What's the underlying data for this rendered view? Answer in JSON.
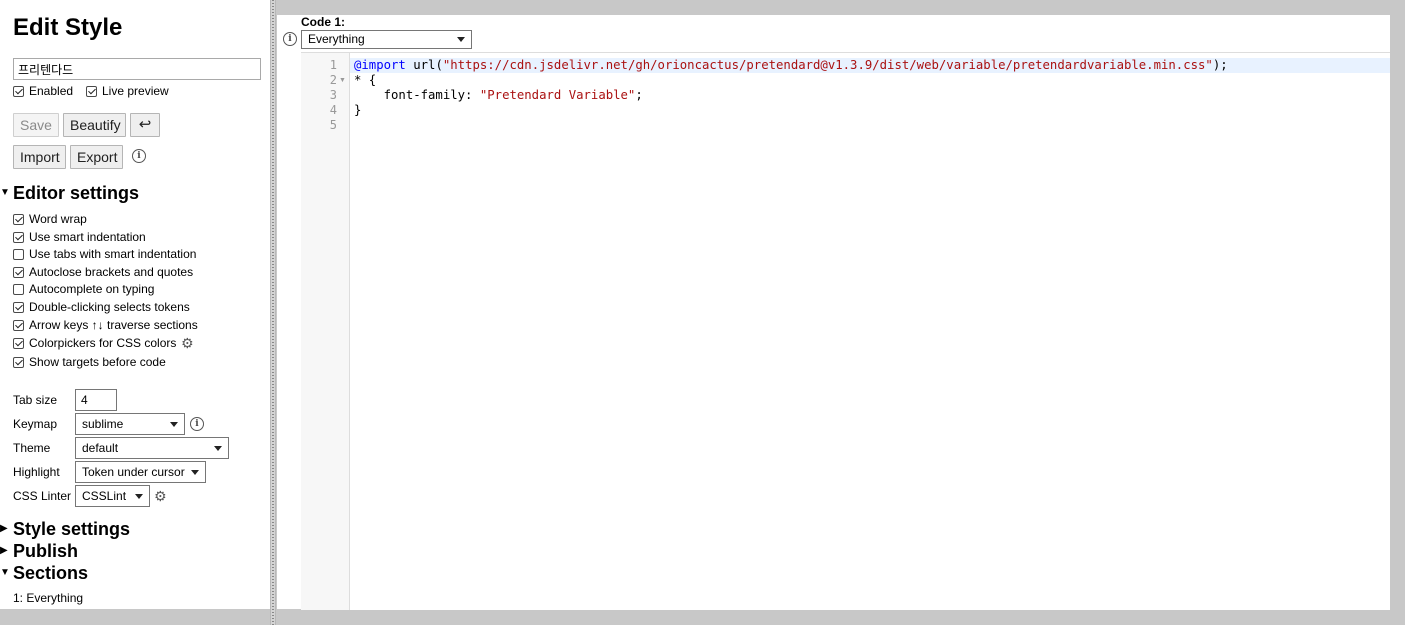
{
  "sidebar": {
    "title": "Edit Style",
    "style_name": "프리텐다드",
    "enabled_label": "Enabled",
    "live_preview_label": "Live preview",
    "save_label": "Save",
    "beautify_label": "Beautify",
    "undo_glyph": "↩",
    "import_label": "Import",
    "export_label": "Export",
    "editor_settings": {
      "heading": "Editor settings",
      "options": [
        {
          "label": "Word wrap",
          "checked": true
        },
        {
          "label": "Use smart indentation",
          "checked": true
        },
        {
          "label": "Use tabs with smart indentation",
          "checked": false
        },
        {
          "label": "Autoclose brackets and quotes",
          "checked": true
        },
        {
          "label": "Autocomplete on typing",
          "checked": false
        },
        {
          "label": "Double-clicking selects tokens",
          "checked": true
        },
        {
          "label": "Arrow keys ↑↓ traverse sections",
          "checked": true
        },
        {
          "label": "Colorpickers for CSS colors",
          "checked": true
        },
        {
          "label": "Show targets before code",
          "checked": true
        }
      ],
      "tab_size_label": "Tab size",
      "tab_size_value": "4",
      "keymap_label": "Keymap",
      "keymap_value": "sublime",
      "theme_label": "Theme",
      "theme_value": "default",
      "highlight_label": "Highlight",
      "highlight_value": "Token under cursor",
      "linter_label": "CSS Linter",
      "linter_value": "CSSLint"
    },
    "style_settings_heading": "Style settings",
    "publish_heading": "Publish",
    "sections_heading": "Sections",
    "sections_list": [
      "1: Everything"
    ]
  },
  "main": {
    "code_label": "Code 1:",
    "applies_to": "Everything",
    "line_numbers": [
      "1",
      "2",
      "3",
      "4",
      "5"
    ],
    "code": {
      "line1_kw": "@import",
      "line1_fn": " url(",
      "line1_str": "\"https://cdn.jsdelivr.net/gh/orioncactus/pretendard@v1.3.9/dist/web/variable/pretendardvariable.min.css\"",
      "line1_end": ");",
      "line2": "* {",
      "line3_prop": "    font-family: ",
      "line3_str": "\"Pretendard Variable\"",
      "line3_end": ";",
      "line4": "}",
      "line5": ""
    }
  },
  "icons": {
    "info": "info-icon",
    "gear": "gear-icon",
    "expanded": "triangle-down-icon",
    "collapsed": "triangle-right-icon"
  }
}
